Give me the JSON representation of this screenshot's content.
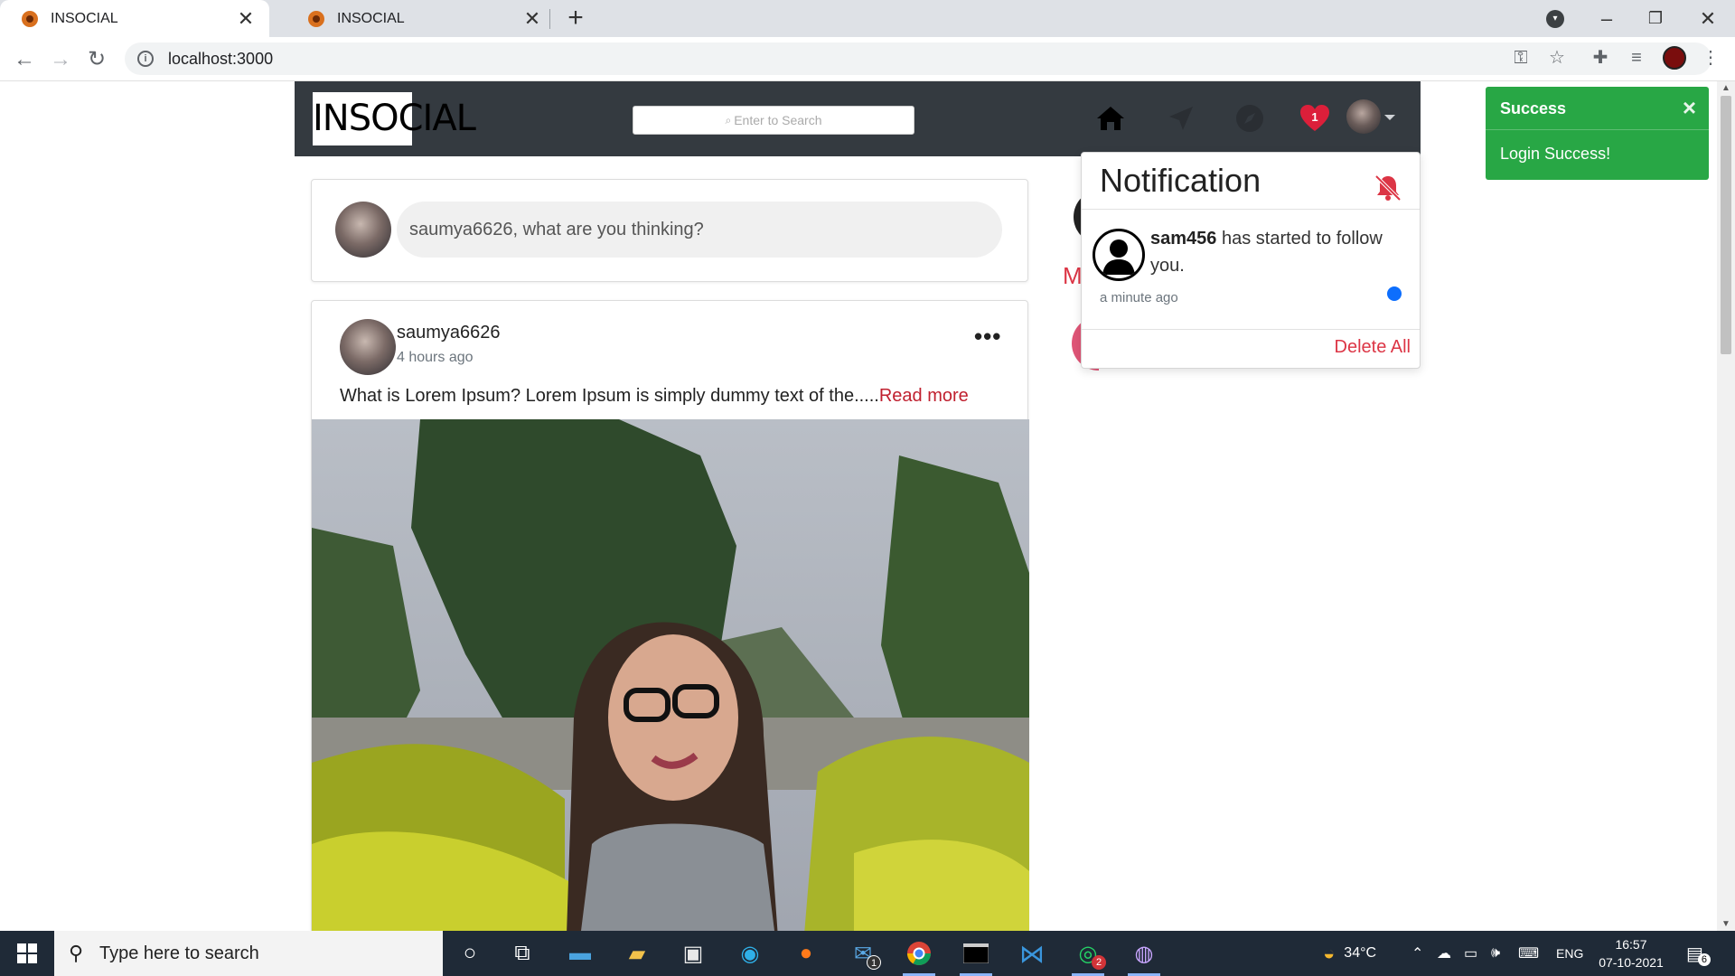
{
  "browser": {
    "tabs": [
      {
        "title": "INSOCIAL",
        "active": true
      },
      {
        "title": "INSOCIAL",
        "active": false
      }
    ],
    "url": "localhost:3000"
  },
  "app": {
    "brand": "INSOCIAL",
    "search_placeholder": "Enter to Search",
    "notification_count": "1",
    "status_placeholder": "saumya6626, what are you thinking?",
    "post": {
      "username": "saumya6626",
      "time": "4 hours ago",
      "text": "What is Lorem Ipsum? Lorem Ipsum is simply dummy text of the.....",
      "read_more": "Read more",
      "menu": "•••"
    },
    "sidebar_partial_letter": "M"
  },
  "notification_panel": {
    "title": "Notification",
    "items": [
      {
        "user": "sam456",
        "message": " has started to follow you.",
        "time": "a minute ago",
        "unread": true
      }
    ],
    "delete_all": "Delete All"
  },
  "toast": {
    "title": "Success",
    "close": "×",
    "message": "Login Success!",
    "color": "#28a745"
  },
  "taskbar": {
    "search_placeholder": "Type here to search",
    "weather": "34°C",
    "language": "ENG",
    "time": "16:57",
    "date": "07-10-2021",
    "mail_badge": "1",
    "whatsapp_badge": "2",
    "notification_count": "6"
  },
  "colors": {
    "navbar": "#343a40",
    "accent_red": "#dc3545",
    "unread_dot": "#0d6efd"
  }
}
